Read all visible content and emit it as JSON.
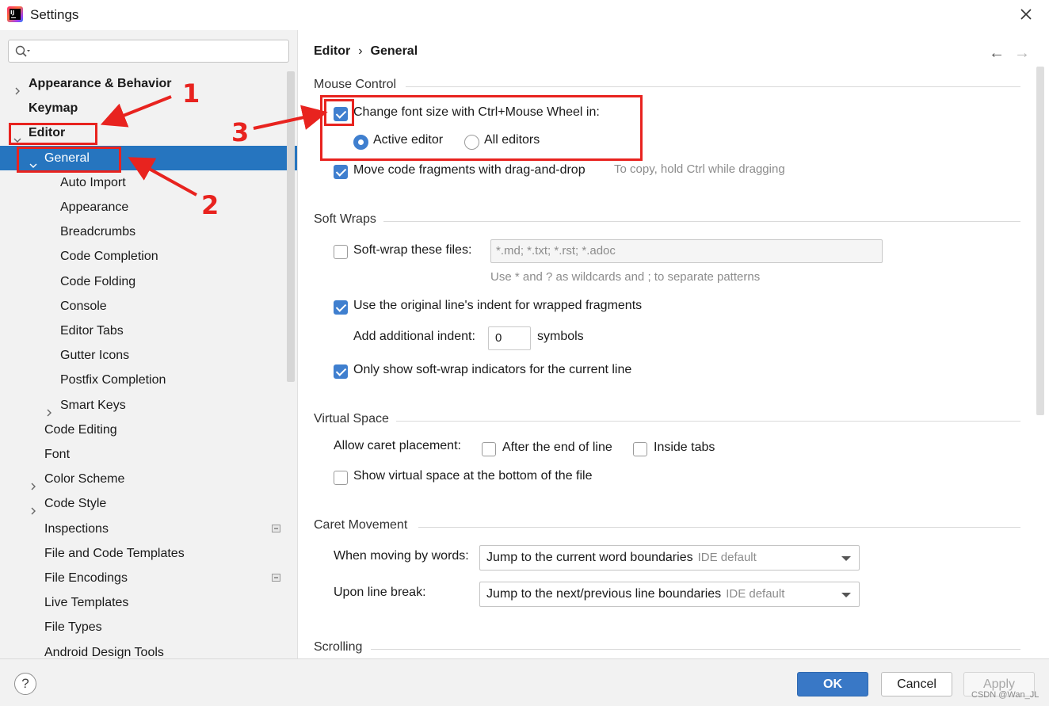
{
  "window": {
    "title": "Settings"
  },
  "search": {
    "placeholder": ""
  },
  "tree": [
    {
      "label": "Appearance & Behavior",
      "name": "tree-item-appearance-behavior",
      "bold": true,
      "chevron": "right",
      "indent": 0
    },
    {
      "label": "Keymap",
      "name": "tree-item-keymap",
      "bold": true,
      "chevron": "",
      "indent": 0
    },
    {
      "label": "Editor",
      "name": "tree-item-editor",
      "bold": true,
      "chevron": "down",
      "indent": 0
    },
    {
      "label": "General",
      "name": "tree-item-general",
      "bold": false,
      "chevron": "down",
      "indent": 1,
      "selected": true
    },
    {
      "label": "Auto Import",
      "name": "tree-item-auto-import",
      "bold": false,
      "chevron": "",
      "indent": 2
    },
    {
      "label": "Appearance",
      "name": "tree-item-appearance",
      "bold": false,
      "chevron": "",
      "indent": 2
    },
    {
      "label": "Breadcrumbs",
      "name": "tree-item-breadcrumbs",
      "bold": false,
      "chevron": "",
      "indent": 2
    },
    {
      "label": "Code Completion",
      "name": "tree-item-code-completion",
      "bold": false,
      "chevron": "",
      "indent": 2
    },
    {
      "label": "Code Folding",
      "name": "tree-item-code-folding",
      "bold": false,
      "chevron": "",
      "indent": 2
    },
    {
      "label": "Console",
      "name": "tree-item-console",
      "bold": false,
      "chevron": "",
      "indent": 2
    },
    {
      "label": "Editor Tabs",
      "name": "tree-item-editor-tabs",
      "bold": false,
      "chevron": "",
      "indent": 2
    },
    {
      "label": "Gutter Icons",
      "name": "tree-item-gutter-icons",
      "bold": false,
      "chevron": "",
      "indent": 2
    },
    {
      "label": "Postfix Completion",
      "name": "tree-item-postfix-completion",
      "bold": false,
      "chevron": "",
      "indent": 2
    },
    {
      "label": "Smart Keys",
      "name": "tree-item-smart-keys",
      "bold": false,
      "chevron": "right",
      "indent": 2
    },
    {
      "label": "Code Editing",
      "name": "tree-item-code-editing",
      "bold": false,
      "chevron": "",
      "indent": 1
    },
    {
      "label": "Font",
      "name": "tree-item-font",
      "bold": false,
      "chevron": "",
      "indent": 1
    },
    {
      "label": "Color Scheme",
      "name": "tree-item-color-scheme",
      "bold": false,
      "chevron": "right",
      "indent": 1
    },
    {
      "label": "Code Style",
      "name": "tree-item-code-style",
      "bold": false,
      "chevron": "right",
      "indent": 1
    },
    {
      "label": "Inspections",
      "name": "tree-item-inspections",
      "bold": false,
      "chevron": "",
      "indent": 1,
      "badge": true
    },
    {
      "label": "File and Code Templates",
      "name": "tree-item-file-code-templates",
      "bold": false,
      "chevron": "",
      "indent": 1
    },
    {
      "label": "File Encodings",
      "name": "tree-item-file-encodings",
      "bold": false,
      "chevron": "",
      "indent": 1,
      "badge": true
    },
    {
      "label": "Live Templates",
      "name": "tree-item-live-templates",
      "bold": false,
      "chevron": "",
      "indent": 1
    },
    {
      "label": "File Types",
      "name": "tree-item-file-types",
      "bold": false,
      "chevron": "",
      "indent": 1
    },
    {
      "label": "Android Design Tools",
      "name": "tree-item-android-design-tools",
      "bold": false,
      "chevron": "",
      "indent": 1
    }
  ],
  "breadcrumb": {
    "first": "Editor",
    "separator": "›",
    "second": "General"
  },
  "nav": {
    "back": "←",
    "forward": "→"
  },
  "mouse_control": {
    "title": "Mouse Control",
    "change_font": {
      "label": "Change font size with Ctrl+Mouse Wheel in:",
      "checked": true
    },
    "radio_active": {
      "label": "Active editor",
      "selected": true
    },
    "radio_all": {
      "label": "All editors",
      "selected": false
    },
    "drag_drop": {
      "label": "Move code fragments with drag-and-drop",
      "checked": true,
      "hint": "To copy, hold Ctrl while dragging"
    }
  },
  "soft_wraps": {
    "title": "Soft Wraps",
    "soft_wrap_files": {
      "label": "Soft-wrap these files:",
      "checked": false,
      "value": "*.md; *.txt; *.rst; *.adoc",
      "hint": "Use * and ? as wildcards and ; to separate patterns"
    },
    "original_indent": {
      "label": "Use the original line's indent for wrapped fragments",
      "checked": true
    },
    "additional_indent": {
      "label": "Add additional indent:",
      "value": "0",
      "unit": "symbols"
    },
    "indicators": {
      "label": "Only show soft-wrap indicators for the current line",
      "checked": true
    }
  },
  "virtual_space": {
    "title": "Virtual Space",
    "caret_label": "Allow caret placement:",
    "after_end": {
      "label": "After the end of line",
      "checked": false
    },
    "inside_tabs": {
      "label": "Inside tabs",
      "checked": false
    },
    "show_virtual": {
      "label": "Show virtual space at the bottom of the file",
      "checked": false
    }
  },
  "caret_movement": {
    "title": "Caret Movement",
    "by_words": {
      "label": "When moving by words:",
      "value": "Jump to the current word boundaries",
      "default": "IDE default"
    },
    "line_break": {
      "label": "Upon line break:",
      "value": "Jump to the next/previous line boundaries",
      "default": "IDE default"
    }
  },
  "scrolling": {
    "title": "Scrolling"
  },
  "footer": {
    "help": "?",
    "ok": "OK",
    "cancel": "Cancel",
    "apply": "Apply",
    "watermark": "CSDN @Wan_JL"
  },
  "annotations": {
    "one": "1",
    "two": "2",
    "three": "3"
  },
  "colors": {
    "selection": "#2675bf",
    "accent": "#3f7fcf",
    "annotation": "#e8231f"
  }
}
